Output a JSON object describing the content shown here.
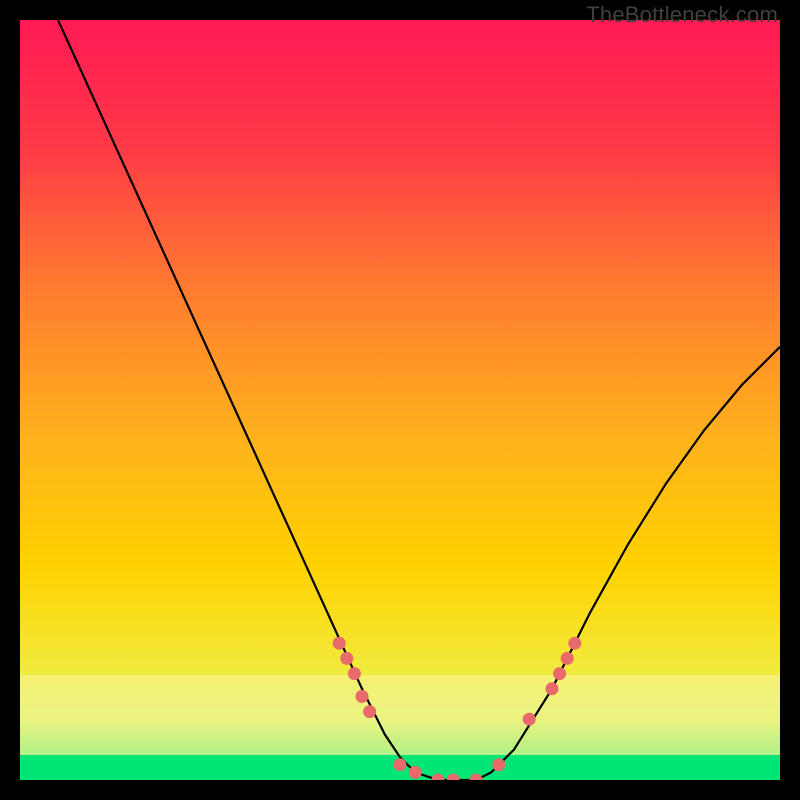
{
  "watermark": "TheBottleneck.com",
  "chart_data": {
    "type": "line",
    "title": "",
    "xlabel": "",
    "ylabel": "",
    "xlim": [
      0,
      100
    ],
    "ylim": [
      0,
      100
    ],
    "background_gradient": {
      "top": "#ff1a54",
      "mid": "#ffd200",
      "bottom": "#00e676"
    },
    "green_band": {
      "from_y": 0,
      "to_y": 4
    },
    "yellow_band": {
      "from_y": 4,
      "to_y": 14
    },
    "curve": {
      "name": "bottleneck-curve",
      "color": "#000000",
      "x": [
        5,
        10,
        15,
        20,
        25,
        30,
        35,
        40,
        45,
        48,
        50,
        52,
        55,
        58,
        60,
        62,
        65,
        70,
        75,
        80,
        85,
        90,
        95,
        100
      ],
      "y": [
        100,
        89,
        78,
        67,
        56,
        45,
        34,
        23,
        12,
        6,
        3,
        1,
        0,
        0,
        0,
        1,
        4,
        12,
        22,
        31,
        39,
        46,
        52,
        57
      ]
    },
    "markers": {
      "name": "highlight-dots",
      "color": "#e86a6a",
      "points": [
        {
          "x": 42,
          "y": 18
        },
        {
          "x": 43,
          "y": 16
        },
        {
          "x": 44,
          "y": 14
        },
        {
          "x": 45,
          "y": 11
        },
        {
          "x": 46,
          "y": 9
        },
        {
          "x": 50,
          "y": 2
        },
        {
          "x": 52,
          "y": 1
        },
        {
          "x": 55,
          "y": 0
        },
        {
          "x": 57,
          "y": 0
        },
        {
          "x": 60,
          "y": 0
        },
        {
          "x": 63,
          "y": 2
        },
        {
          "x": 67,
          "y": 8
        },
        {
          "x": 70,
          "y": 12
        },
        {
          "x": 71,
          "y": 14
        },
        {
          "x": 72,
          "y": 16
        },
        {
          "x": 73,
          "y": 18
        }
      ]
    }
  }
}
